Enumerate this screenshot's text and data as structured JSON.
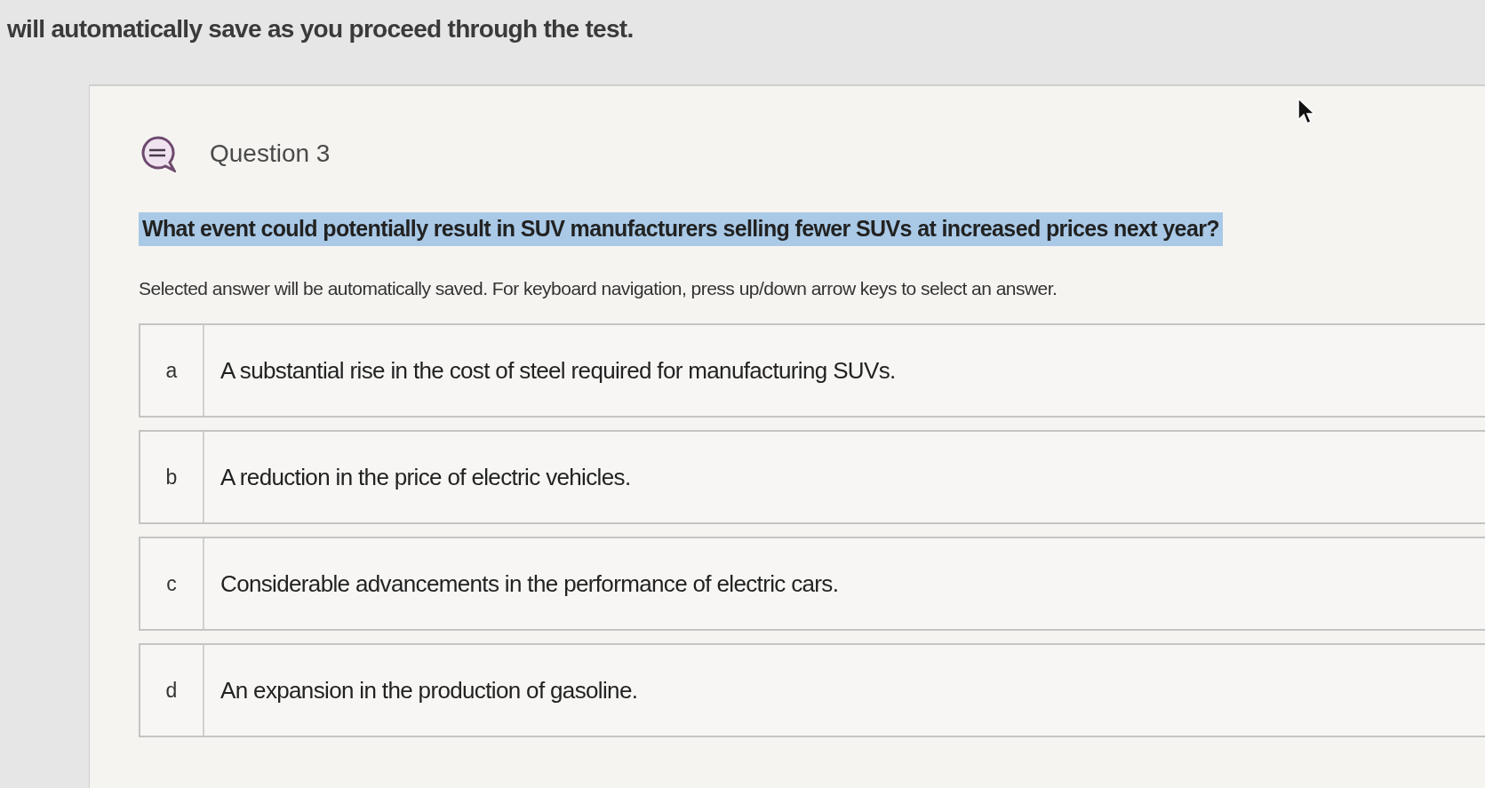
{
  "header": {
    "notice": "will automatically save as you proceed through the test."
  },
  "question": {
    "title": "Question 3",
    "text": "What event could potentially result in SUV manufacturers selling fewer SUVs at increased prices next year?",
    "highlighted": true,
    "instructions": "Selected answer will be automatically saved. For keyboard navigation, press up/down arrow keys to select an answer."
  },
  "answers": [
    {
      "letter": "a",
      "text": "A substantial rise in the cost of steel required for manufacturing SUVs.",
      "selected": false
    },
    {
      "letter": "b",
      "text": "A reduction in the price of electric vehicles.",
      "selected": false
    },
    {
      "letter": "c",
      "text": "Considerable advancements in the performance of electric cars.",
      "selected": false
    },
    {
      "letter": "d",
      "text": "An expansion in the production of gasoline.",
      "selected": false
    }
  ]
}
